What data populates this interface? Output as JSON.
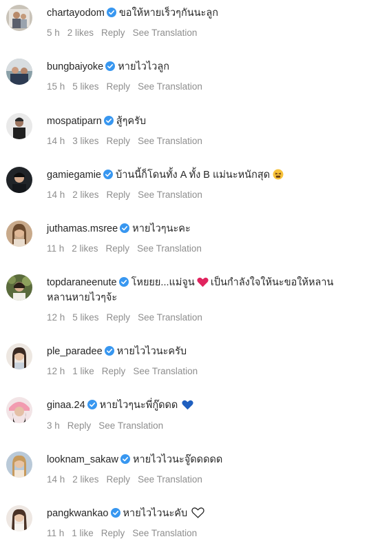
{
  "comments": [
    {
      "username": "chartayodom",
      "text": "ขอให้หายเร็วๆกันนะลูก",
      "time": "5 h",
      "likes": "2 likes",
      "reply": "Reply",
      "translate": "See Translation"
    },
    {
      "username": "bungbaiyoke",
      "text": "หายไวไวลูก",
      "time": "15 h",
      "likes": "5 likes",
      "reply": "Reply",
      "translate": "See Translation"
    },
    {
      "username": "mospatiparn",
      "text": "สู้ๆครับ",
      "time": "14 h",
      "likes": "3 likes",
      "reply": "Reply",
      "translate": "See Translation"
    },
    {
      "username": "gamiegamie",
      "text": "บ้านนี้ก็โดนทั้ง A ทั้ง B แม่นะหนักสุด",
      "emoji": "tired-face-emoji",
      "time": "14 h",
      "likes": "2 likes",
      "reply": "Reply",
      "translate": "See Translation"
    },
    {
      "username": "juthamas.msree",
      "text": "หายไวๆนะคะ",
      "time": "11 h",
      "likes": "2 likes",
      "reply": "Reply",
      "translate": "See Translation"
    },
    {
      "username": "topdaraneenute",
      "text_a": "โหยยย...แม่จูน",
      "text_b": "เป็นกำลังใจให้นะขอให้หลานหลานหายไวๆจ้ะ",
      "emoji": "red-heart-emoji",
      "time": "12 h",
      "likes": "5 likes",
      "reply": "Reply",
      "translate": "See Translation"
    },
    {
      "username": "ple_paradee",
      "text": "หายไวไวนะครับ",
      "time": "12 h",
      "likes": "1 like",
      "reply": "Reply",
      "translate": "See Translation"
    },
    {
      "username": "ginaa.24",
      "text": "หายไวๆนะพี่กู๊ดดด",
      "emoji": "blue-heart-emoji",
      "time": "3 h",
      "reply": "Reply",
      "translate": "See Translation"
    },
    {
      "username": "looknam_sakaw",
      "text": "หายไวไวนะจู๊ดดดดด",
      "time": "14 h",
      "likes": "2 likes",
      "reply": "Reply",
      "translate": "See Translation"
    },
    {
      "username": "pangkwankao",
      "text": "หายไวไวนะคับ",
      "emoji": "white-heart-emoji",
      "time": "11 h",
      "likes": "1 like",
      "reply": "Reply",
      "translate": "See Translation"
    }
  ],
  "colors": {
    "verified": "#3897f0",
    "meta_text": "#8e8e8e",
    "primary_text": "#262626",
    "red_heart": "#e0245e",
    "blue_heart": "#1f5fbf"
  }
}
